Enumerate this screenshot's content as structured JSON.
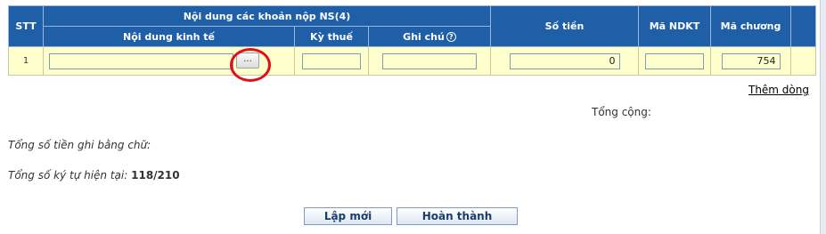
{
  "table": {
    "header": {
      "stt": "STT",
      "group": "Nội dung các khoản nộp NS(4)",
      "noi_dung": "Nội dung kinh tế",
      "ky_thue": "Kỳ thuế",
      "ghi_chu": "Ghi chú",
      "help_glyph": "?",
      "so_tien": "Số tiền",
      "ma_ndkt": "Mã NDKT",
      "ma_chuong": "Mã chương"
    },
    "rows": [
      {
        "stt": "1",
        "noi_dung": "",
        "browse_label": "...",
        "ky_thue": "",
        "ghi_chu": "",
        "so_tien": "0",
        "ma_ndkt": "",
        "ma_chuong": "754"
      }
    ]
  },
  "add_row_link": "Thêm dòng",
  "total_label": "Tổng cộng:",
  "amount_in_words_label": "Tổng số tiền ghi bằng chữ:",
  "char_count_label": "Tổng số ký tự hiện tại:",
  "char_count_value": "118/210",
  "buttons": {
    "new": "Lập mới",
    "finish": "Hoàn thành"
  },
  "colors": {
    "header_bg": "#1f5fa8",
    "row_bg": "#ffffcc",
    "highlight_circle": "#e0101b"
  }
}
